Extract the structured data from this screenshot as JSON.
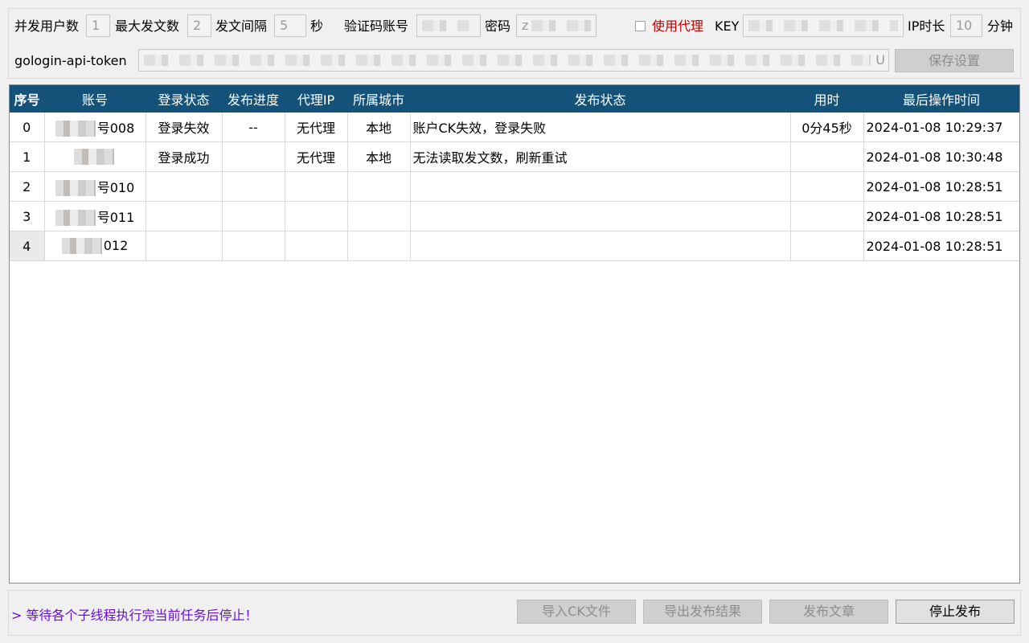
{
  "settings": {
    "concurrent_users_label": "并发用户数",
    "concurrent_users_value": "1",
    "max_posts_label": "最大发文数",
    "max_posts_value": "2",
    "interval_label": "发文间隔",
    "interval_value": "5",
    "interval_unit": "秒",
    "captcha_account_label": "验证码账号",
    "password_label": "密码",
    "password_value_visible": "z",
    "use_proxy_label": "使用代理",
    "use_proxy_checked": false,
    "key_label": "KEY",
    "ip_duration_label": "IP时长",
    "ip_duration_value": "10",
    "ip_duration_unit": "分钟",
    "token_label": "gologin-api-token",
    "token_value_visible_end": "U",
    "save_button": "保存设置"
  },
  "table": {
    "columns": [
      "序号",
      "账号",
      "登录状态",
      "发布进度",
      "代理IP",
      "所属城市",
      "发布状态",
      "用时",
      "最后操作时间"
    ],
    "rows": [
      {
        "index": "0",
        "account": "号008",
        "login_status": "登录失效",
        "progress": "--",
        "proxy_ip": "无代理",
        "city": "本地",
        "publish_status": "账户CK失效，登录失败",
        "elapsed": "0分45秒",
        "last_time": "2024-01-08 10:29:37"
      },
      {
        "index": "1",
        "account": "",
        "login_status": "登录成功",
        "progress": "",
        "proxy_ip": "无代理",
        "city": "本地",
        "publish_status": "无法读取发文数，刷新重试",
        "elapsed": "",
        "last_time": "2024-01-08 10:30:48"
      },
      {
        "index": "2",
        "account": "号010",
        "login_status": "",
        "progress": "",
        "proxy_ip": "",
        "city": "",
        "publish_status": "",
        "elapsed": "",
        "last_time": "2024-01-08 10:28:51"
      },
      {
        "index": "3",
        "account": "号011",
        "login_status": "",
        "progress": "",
        "proxy_ip": "",
        "city": "",
        "publish_status": "",
        "elapsed": "",
        "last_time": "2024-01-08 10:28:51"
      },
      {
        "index": "4",
        "account": "012",
        "login_status": "",
        "progress": "",
        "proxy_ip": "",
        "city": "",
        "publish_status": "",
        "elapsed": "",
        "last_time": "2024-01-08 10:28:51"
      }
    ]
  },
  "footer": {
    "status_message": "> 等待各个子线程执行完当前任务后停止！",
    "import_ck_button": "导入CK文件",
    "export_results_button": "导出发布结果",
    "publish_button": "发布文章",
    "stop_button": "停止发布"
  },
  "colors": {
    "header_bg": "#15527a",
    "proxy_label": "#c00000",
    "status_message": "#6a0fd6"
  }
}
